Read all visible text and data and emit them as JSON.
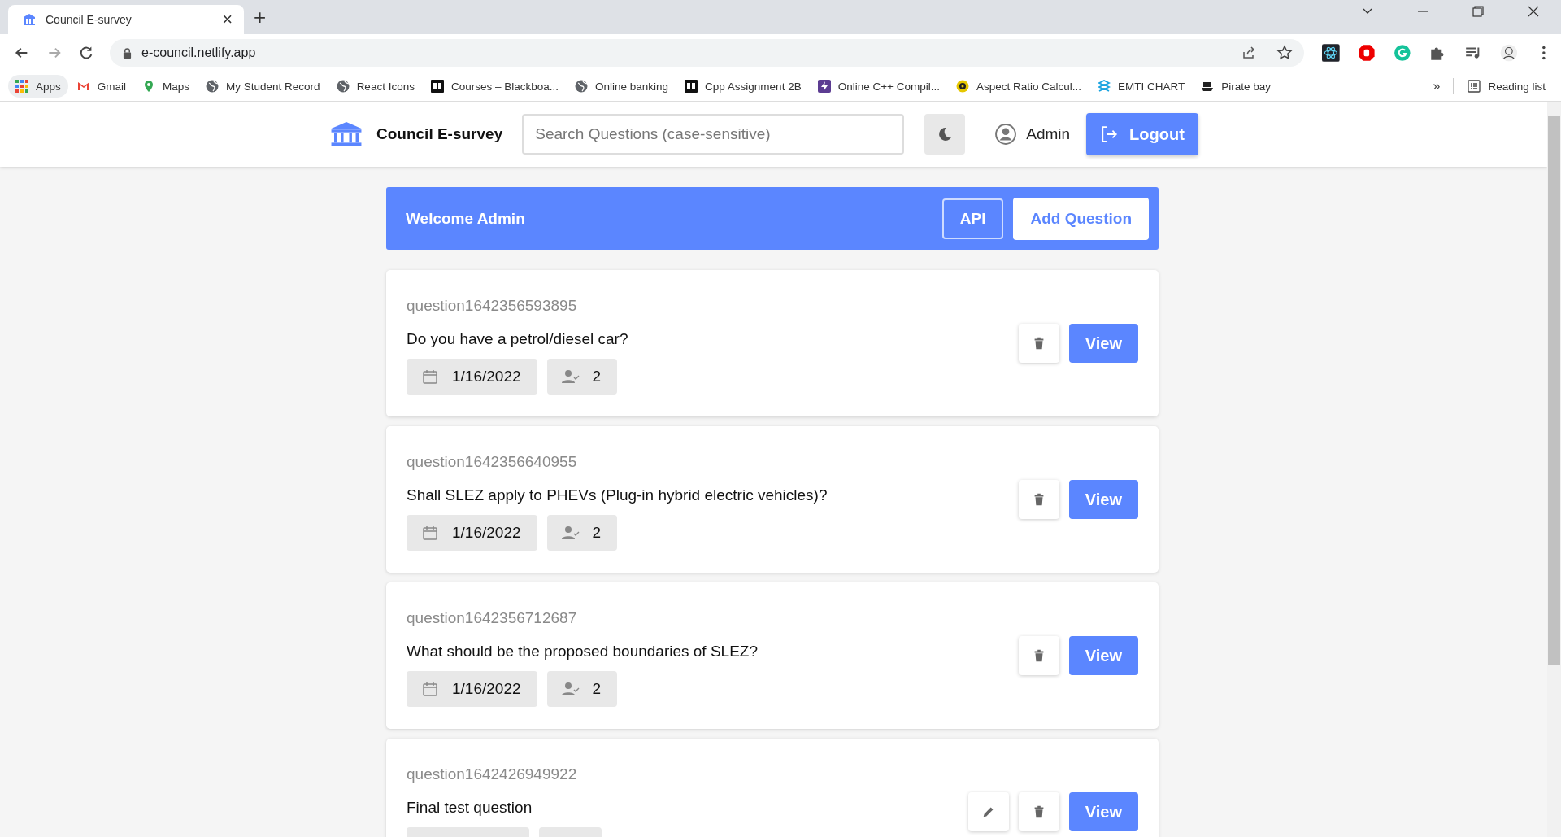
{
  "browser": {
    "tab": {
      "title": "Council E-survey",
      "close": "×"
    },
    "new_tab": "+",
    "address": "e-council.netlify.app",
    "bookmarks": [
      {
        "label": "Apps",
        "kind": "apps"
      },
      {
        "label": "Gmail",
        "kind": "gmail"
      },
      {
        "label": "Maps",
        "kind": "maps"
      },
      {
        "label": "My Student Record",
        "kind": "globe"
      },
      {
        "label": "React Icons",
        "kind": "globe"
      },
      {
        "label": "Courses – Blackboa...",
        "kind": "bb"
      },
      {
        "label": "Online banking",
        "kind": "globe"
      },
      {
        "label": "Cpp Assignment 2B",
        "kind": "bb"
      },
      {
        "label": "Online C++ Compil...",
        "kind": "bolt"
      },
      {
        "label": "Aspect Ratio Calcul...",
        "kind": "aspect"
      },
      {
        "label": "EMTI CHART",
        "kind": "emti"
      },
      {
        "label": "Pirate bay",
        "kind": "pirate"
      }
    ],
    "more": "»",
    "reading_list": "Reading list"
  },
  "header": {
    "title": "Council E-survey",
    "search": {
      "placeholder": "Search Questions (case-sensitive)"
    },
    "user": "Admin",
    "logout": "Logout"
  },
  "banner": {
    "welcome": "Welcome Admin",
    "api": "API",
    "add": "Add Question"
  },
  "questions": [
    {
      "id": "question1642356593895",
      "text": "Do you have a petrol/diesel car?",
      "date": "1/16/2022",
      "responses": "2",
      "editable": false,
      "view": "View"
    },
    {
      "id": "question1642356640955",
      "text": "Shall SLEZ apply to PHEVs (Plug-in hybrid electric vehicles)?",
      "date": "1/16/2022",
      "responses": "2",
      "editable": false,
      "view": "View"
    },
    {
      "id": "question1642356712687",
      "text": "What should be the proposed boundaries of SLEZ?",
      "date": "1/16/2022",
      "responses": "2",
      "editable": false,
      "view": "View"
    },
    {
      "id": "question1642426949922",
      "text": "Final test question",
      "editable": true,
      "view": "View"
    }
  ]
}
